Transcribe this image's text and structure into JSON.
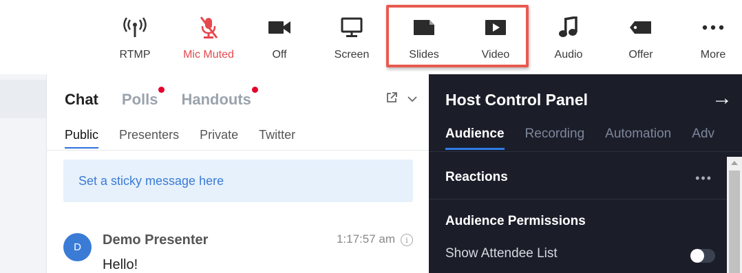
{
  "toolbar": {
    "items": [
      {
        "label": "RTMP",
        "icon": "broadcast-icon"
      },
      {
        "label": "Mic Muted",
        "icon": "mic-muted-icon"
      },
      {
        "label": "Off",
        "icon": "camera-icon"
      },
      {
        "label": "Screen",
        "icon": "monitor-icon"
      },
      {
        "label": "Slides",
        "icon": "slides-icon"
      },
      {
        "label": "Video",
        "icon": "video-play-icon"
      },
      {
        "label": "Audio",
        "icon": "music-note-icon"
      },
      {
        "label": "Offer",
        "icon": "offer-tag-icon"
      },
      {
        "label": "More",
        "icon": "more-dots-icon"
      }
    ]
  },
  "chat": {
    "tabs": [
      {
        "label": "Chat",
        "notification": false
      },
      {
        "label": "Polls",
        "notification": true
      },
      {
        "label": "Handouts",
        "notification": true
      }
    ],
    "sub_tabs": [
      "Public",
      "Presenters",
      "Private",
      "Twitter"
    ],
    "sticky_placeholder": "Set a sticky message here",
    "message": {
      "avatar_initial": "D",
      "author": "Demo Presenter",
      "time": "1:17:57 am",
      "text": "Hello!"
    }
  },
  "host_panel": {
    "title": "Host Control Panel",
    "tabs": [
      "Audience",
      "Recording",
      "Automation",
      "Adv"
    ],
    "reactions_label": "Reactions",
    "permissions_label": "Audience Permissions",
    "show_attendee_list_label": "Show Attendee List",
    "show_attendee_list_on": false
  },
  "colors": {
    "accent": "#2f7be8",
    "muted_red": "#e5484d",
    "notification_dot": "#e4002b",
    "highlight_box": "#e85a4f",
    "panel_dark": "#1b1e29"
  }
}
